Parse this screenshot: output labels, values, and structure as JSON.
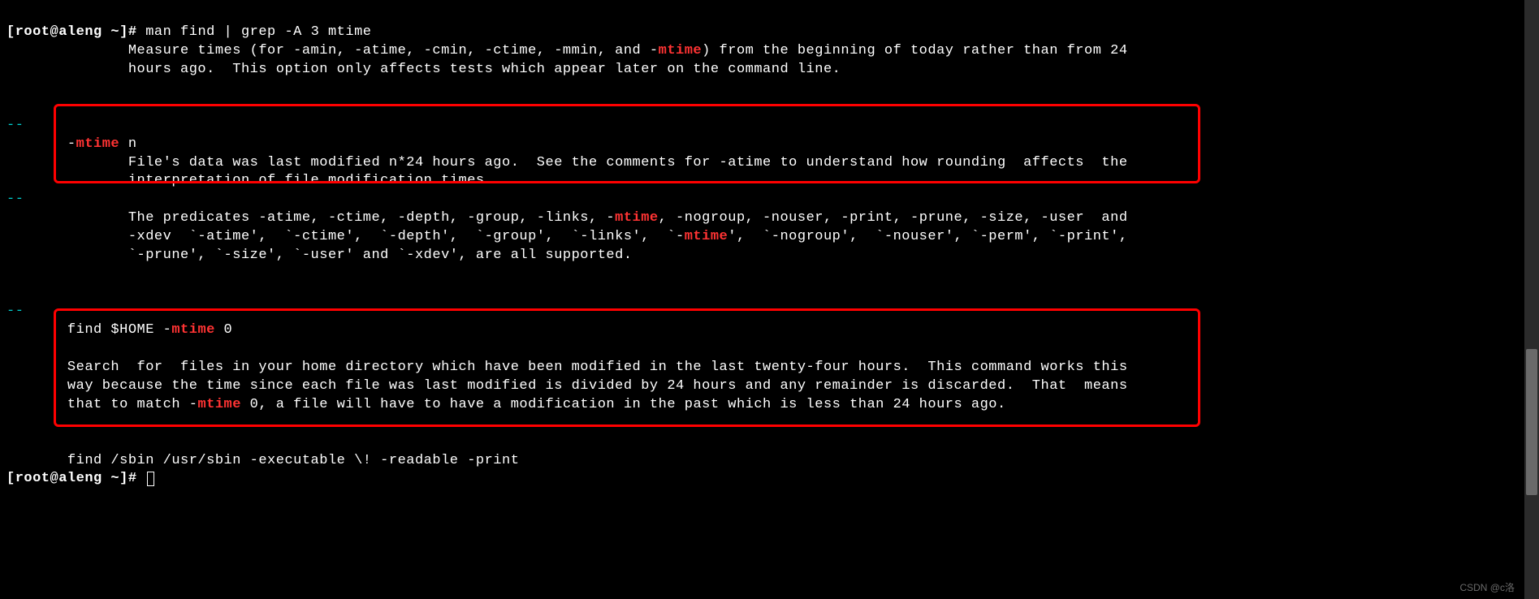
{
  "prompt1": "[root@aleng ~]# ",
  "command": "man find | grep -A 3 mtime",
  "block1_pre": "              Measure times (for -amin, -atime, -cmin, -ctime, -mmin, and -",
  "block1_hl": "mtime",
  "block1_post": ") from the beginning of today rather than from 24",
  "block1_line2": "              hours ago.  This option only affects tests which appear later on the command line.",
  "sep": "--",
  "block2_pre": "       -",
  "block2_hl": "mtime",
  "block2_post": " n",
  "block2_line2": "              File's data was last modified n*24 hours ago.  See the comments for -atime to understand how rounding  affects  the",
  "block2_line3": "              interpretation of file modification times.",
  "block3_pre": "              The predicates -atime, -ctime, -depth, -group, -links, -",
  "block3_hl1": "mtime",
  "block3_mid": ", -nogroup, -nouser, -print, -prune, -size, -user  and",
  "block3_line2a": "              -xdev  `-atime',  `-ctime',  `-depth',  `-group',  `-links',  `-",
  "block3_hl2": "mtime",
  "block3_line2b": "',  `-nogroup',  `-nouser', `-perm', `-print',",
  "block3_line3": "              `-prune', `-size', `-user' and `-xdev', are all supported.",
  "block4_pre": "       find $HOME -",
  "block4_hl": "mtime",
  "block4_post": " 0",
  "block4_line2": "",
  "block4_line3": "       Search  for  files in your home directory which have been modified in the last twenty-four hours.  This command works this",
  "block4_line4": "       way because the time since each file was last modified is divided by 24 hours and any remainder is discarded.  That  means",
  "block4_line5a": "       that to match -",
  "block4_hl2": "mtime",
  "block4_line5b": " 0, a file will have to have a modification in the past which is less than 24 hours ago.",
  "block5": "       find /sbin /usr/sbin -executable \\! -readable -print",
  "prompt2": "[root@aleng ~]# ",
  "watermark": "CSDN @c洛"
}
